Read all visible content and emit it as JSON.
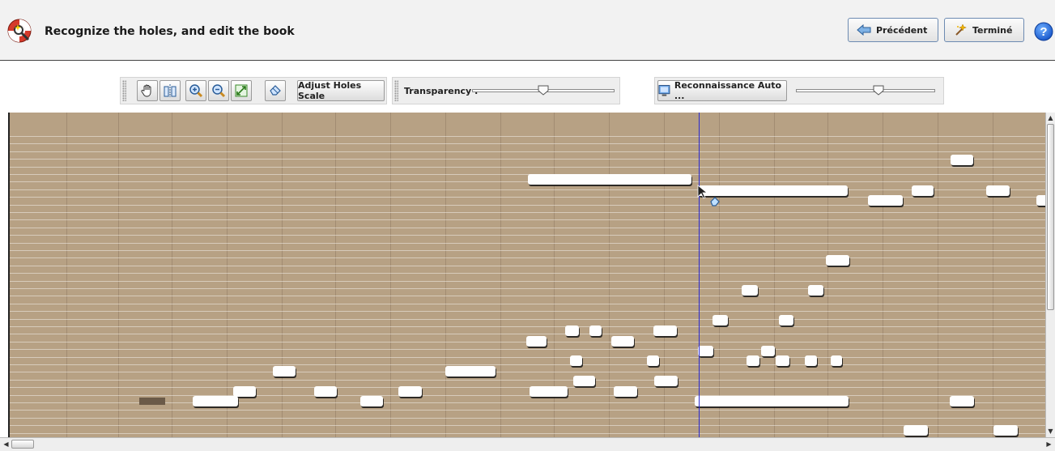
{
  "header": {
    "title": "Recognize the holes, and edit the book",
    "prev_label": "Précédent",
    "done_label": "Terminé",
    "help_icon": "question-icon"
  },
  "toolbar": {
    "tools": [
      "hand-icon",
      "select-columns-icon",
      "zoom-in-icon",
      "zoom-out-icon",
      "fit-icon",
      "eraser-icon"
    ],
    "adjust_label": "Adjust Holes Scale",
    "transparency_label": "Transparency :",
    "transparency_value": 0.5,
    "recognize_label": "Reconnaissance Auto ...",
    "recognize_value": 0.6
  },
  "canvas": {
    "background": "#b7a184",
    "cursor_line_color": "#2b2bd0"
  }
}
